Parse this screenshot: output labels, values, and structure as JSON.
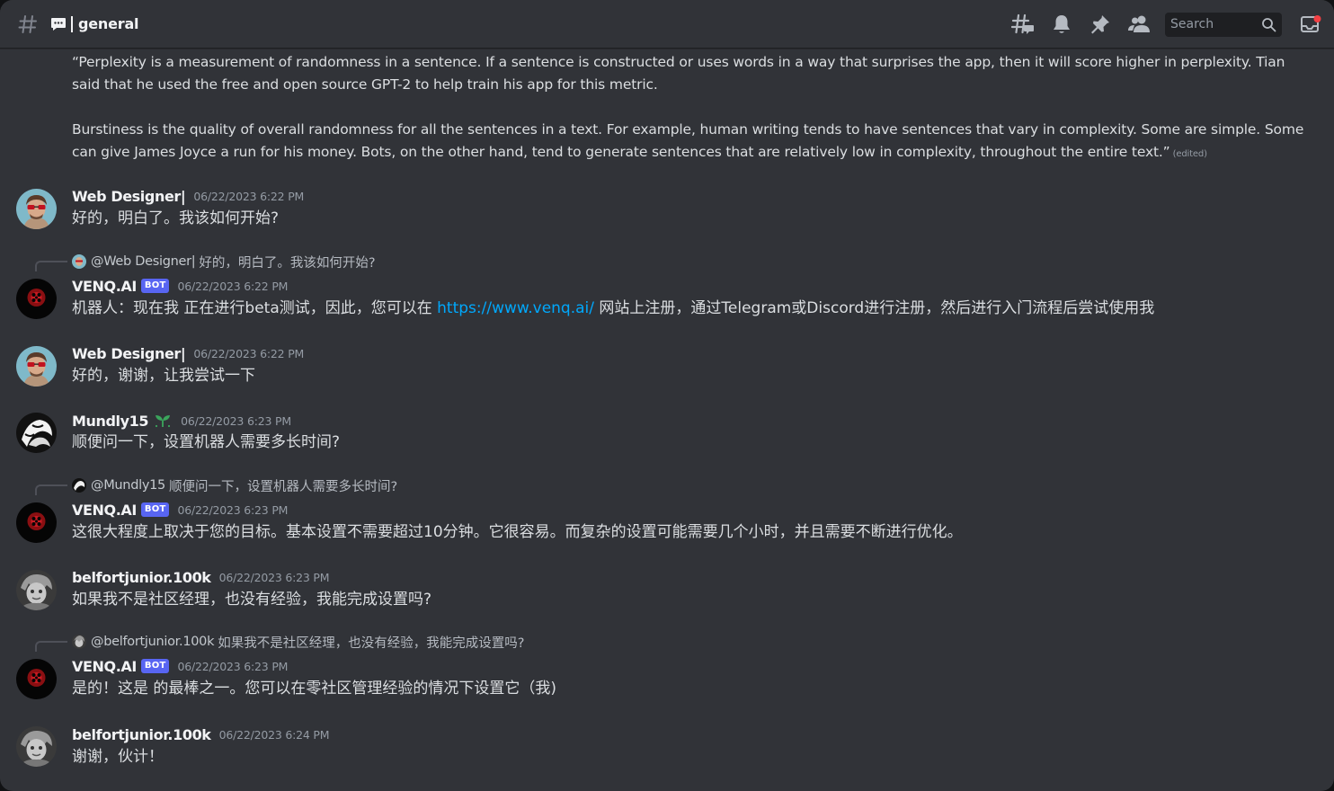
{
  "header": {
    "channel_name": "general",
    "search_placeholder": "Search",
    "icons": [
      "hash-icon",
      "chat-bubble-icon",
      "threads-icon",
      "bell-icon",
      "pin-icon",
      "members-icon",
      "search-icon",
      "inbox-icon"
    ]
  },
  "quote": {
    "paragraph1": "“Perplexity is a measurement of randomness in a sentence. If a sentence is constructed or uses words in a way that surprises the app, then it will score higher in perplexity. Tian said that he used the free and open source GPT-2 to help train his app for this metric.",
    "paragraph2": "Burstiness is the quality of overall randomness for all the sentences in a text. For example, human writing tends to have sentences that vary in complexity. Some are simple. Some can give James Joyce a run for his money. Bots, on the other hand, tend to generate sentences that are relatively low in complexity, throughout the entire text.”",
    "edited": "(edited)"
  },
  "messages": [
    {
      "author": "Web Designer|",
      "timestamp": "06/22/2023 6:22 PM",
      "content": "好的，明白了。我该如何开始?"
    },
    {
      "reply": {
        "user": "@Web Designer|",
        "text": "好的，明白了。我该如何开始?"
      },
      "author": "VENQ.AI",
      "badge": "BOT",
      "timestamp": "06/22/2023 6:22 PM",
      "content_before": "机器人：现在我 正在进行beta测试，因此，您可以在 ",
      "link": "https://www.venq.ai/",
      "content_after": " 网站上注册，通过Telegram或Discord进行注册，然后进行入门流程后尝试使用我"
    },
    {
      "author": "Web Designer|",
      "timestamp": "06/22/2023 6:22 PM",
      "content": "好的，谢谢，让我尝试一下"
    },
    {
      "author": "Mundly15",
      "timestamp": "06/22/2023 6:23 PM",
      "content": "顺便问一下，设置机器人需要多长时间?"
    },
    {
      "reply": {
        "user": "@Mundly15",
        "text": "顺便问一下，设置机器人需要多长时间?"
      },
      "author": "VENQ.AI",
      "badge": "BOT",
      "timestamp": "06/22/2023 6:23 PM",
      "content": "这很大程度上取决于您的目标。基本设置不需要超过10分钟。它很容易。而复杂的设置可能需要几个小时，并且需要不断进行优化。"
    },
    {
      "author": "belfortjunior.100k",
      "timestamp": "06/22/2023 6:23 PM",
      "content": "如果我不是社区经理，也没有经验，我能完成设置吗?"
    },
    {
      "reply": {
        "user": "@belfortjunior.100k",
        "text": "如果我不是社区经理，也没有经验，我能完成设置吗?"
      },
      "author": "VENQ.AI",
      "badge": "BOT",
      "timestamp": "06/22/2023 6:23 PM",
      "content": "是的！这是 的最棒之一。您可以在零社区管理经验的情况下设置它（我)"
    },
    {
      "author": "belfortjunior.100k",
      "timestamp": "06/22/2023 6:24 PM",
      "content": "谢谢，伙计！"
    }
  ],
  "colors": {
    "background": "#313338",
    "bot_badge": "#5865f2",
    "link": "#00a8fc",
    "timestamp": "#949ba4"
  }
}
